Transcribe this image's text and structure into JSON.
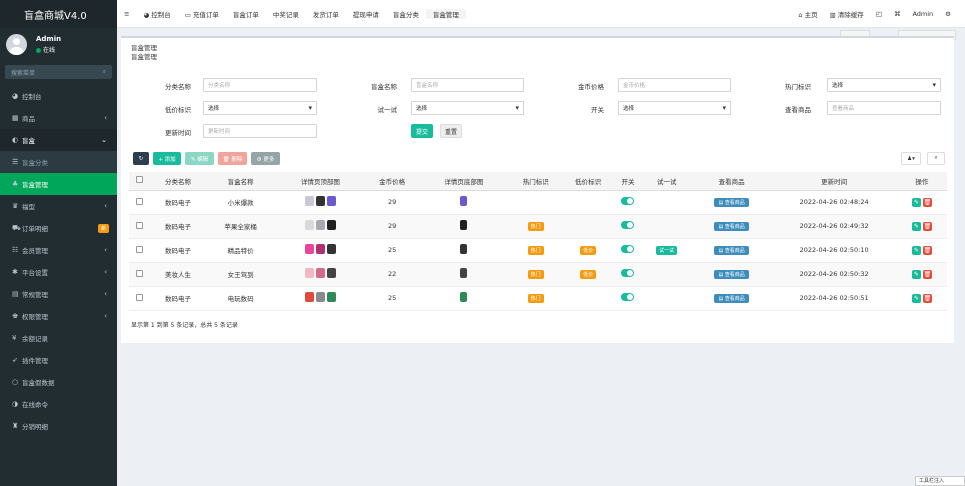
{
  "brand": "盲盒商城V4.0",
  "user": {
    "name": "Admin",
    "status": "在线"
  },
  "sidebar": {
    "search_placeholder": "搜索菜单",
    "items": [
      {
        "icon": "dashboard-icon",
        "glyph": "◕",
        "label": "控制台",
        "cls": ""
      },
      {
        "icon": "shop-icon",
        "glyph": "▦",
        "label": "商品",
        "arrow": "‹",
        "cls": ""
      },
      {
        "icon": "blindbox-icon",
        "glyph": "◐",
        "label": "盲盒",
        "arrow": "⌄",
        "cls": "active"
      },
      {
        "icon": "list-icon",
        "glyph": "☰",
        "label": "盲盒分类",
        "cls": "sub"
      },
      {
        "icon": "manage-icon",
        "glyph": "♣",
        "label": "盲盒管理",
        "cls": "current"
      },
      {
        "icon": "trophy-icon",
        "glyph": "♛",
        "label": "福型",
        "arrow": "‹",
        "cls": ""
      },
      {
        "icon": "cart-icon",
        "glyph": "⛟",
        "label": "订单明细",
        "badge": "新",
        "cls": ""
      },
      {
        "icon": "users-icon",
        "glyph": "☷",
        "label": "会员管理",
        "arrow": "‹",
        "cls": ""
      },
      {
        "icon": "gear-icon",
        "glyph": "✱",
        "label": "平台设置",
        "arrow": "‹",
        "cls": ""
      },
      {
        "icon": "config-icon",
        "glyph": "▤",
        "label": "常规管理",
        "arrow": "‹",
        "cls": ""
      },
      {
        "icon": "perm-icon",
        "glyph": "♚",
        "label": "权限管理",
        "arrow": "‹",
        "cls": ""
      },
      {
        "icon": "yen-icon",
        "glyph": "¥",
        "label": "余额记录",
        "cls": ""
      },
      {
        "icon": "plugin-icon",
        "glyph": "➶",
        "label": "插件管理",
        "cls": ""
      },
      {
        "icon": "circle-icon",
        "glyph": "○",
        "label": "盲盒假数据",
        "cls": ""
      },
      {
        "icon": "online-icon",
        "glyph": "◑",
        "label": "在线命令",
        "cls": ""
      },
      {
        "icon": "sales-icon",
        "glyph": "♜",
        "label": "分销明细",
        "cls": ""
      }
    ]
  },
  "topnav": {
    "menu_glyph": "≡",
    "tabs": [
      {
        "glyph": "◕ ",
        "label": "控制台"
      },
      {
        "glyph": "▭ ",
        "label": "充值订单"
      },
      {
        "glyph": "",
        "label": "盲盒订单"
      },
      {
        "glyph": "",
        "label": "中奖记录"
      },
      {
        "glyph": "",
        "label": "发货订单"
      },
      {
        "glyph": "",
        "label": "提现申请"
      },
      {
        "glyph": "",
        "label": "盲盒分类"
      },
      {
        "glyph": "",
        "label": "盲盒管理"
      }
    ],
    "right": [
      "⌂ 主页",
      "▥ 清除缓存",
      "◰",
      "⌘",
      "Admin",
      "⚙"
    ]
  },
  "page": {
    "title": "盲盒管理",
    "subtitle": "盲盒管理"
  },
  "form": {
    "category": {
      "label": "分类名称",
      "placeholder": "分类名称"
    },
    "name": {
      "label": "盲盒名称",
      "placeholder": "盲盒名称"
    },
    "price": {
      "label": "金币价格",
      "placeholder": "金币价格"
    },
    "hot": {
      "label": "热门标识",
      "value": "选择"
    },
    "low": {
      "label": "低价标识",
      "value": "选择"
    },
    "try": {
      "label": "试一试",
      "value": "选择"
    },
    "switch": {
      "label": "开关",
      "value": "选择"
    },
    "view": {
      "label": "查看商品",
      "placeholder": "查看商品"
    },
    "updated": {
      "label": "更新时间",
      "placeholder": "更新时间"
    },
    "submit": "提交",
    "reset": "重置"
  },
  "toolbar": {
    "refresh": "↻",
    "add": "+ 添加",
    "edit": "✎ 编辑",
    "delete": "🗑 删除",
    "more": "⚙ 更多",
    "columns": "♟▾",
    "search": "⌕"
  },
  "table": {
    "headers": [
      "",
      "分类名称",
      "盲盒名称",
      "详情页顶部图",
      "金币价格",
      "详情页底部图",
      "热门标识",
      "低价标识",
      "开关",
      "试一试",
      "查看商品",
      "更新时间",
      "操作"
    ],
    "hot_label": "热门",
    "low_label": "低价",
    "try_label": "试一试",
    "view_label": "▤ 查看商品",
    "rows": [
      {
        "category": "数码电子",
        "name": "小米爆款",
        "price": "29",
        "hot": false,
        "low": false,
        "try": false,
        "updated": "2022-04-26 02:48:24",
        "colors": [
          "#c9c9d6",
          "#333333",
          "#6a5acd"
        ]
      },
      {
        "category": "数码电子",
        "name": "苹果全家桶",
        "price": "29",
        "hot": true,
        "low": false,
        "try": false,
        "updated": "2022-04-26 02:49:32",
        "colors": [
          "#d9d9d9",
          "#a8a8b0",
          "#222222"
        ]
      },
      {
        "category": "数码电子",
        "name": "精品特价",
        "price": "25",
        "hot": true,
        "low": true,
        "try": true,
        "updated": "2022-04-26 02:50:10",
        "colors": [
          "#e8469b",
          "#b03070",
          "#333333"
        ]
      },
      {
        "category": "美妆人生",
        "name": "女王驾到",
        "price": "22",
        "hot": true,
        "low": true,
        "try": false,
        "updated": "2022-04-26 02:50:32",
        "colors": [
          "#f3b6c4",
          "#d46a8a",
          "#444444"
        ]
      },
      {
        "category": "数码电子",
        "name": "电玩数码",
        "price": "25",
        "hot": true,
        "low": false,
        "try": false,
        "updated": "2022-04-26 02:50:51",
        "colors": [
          "#e04a3a",
          "#8a8a8a",
          "#2e8b57"
        ]
      }
    ]
  },
  "pager": "显示第 1 到第 5 条记录，总共 5 条记录",
  "corner_note": "工具栏注入"
}
